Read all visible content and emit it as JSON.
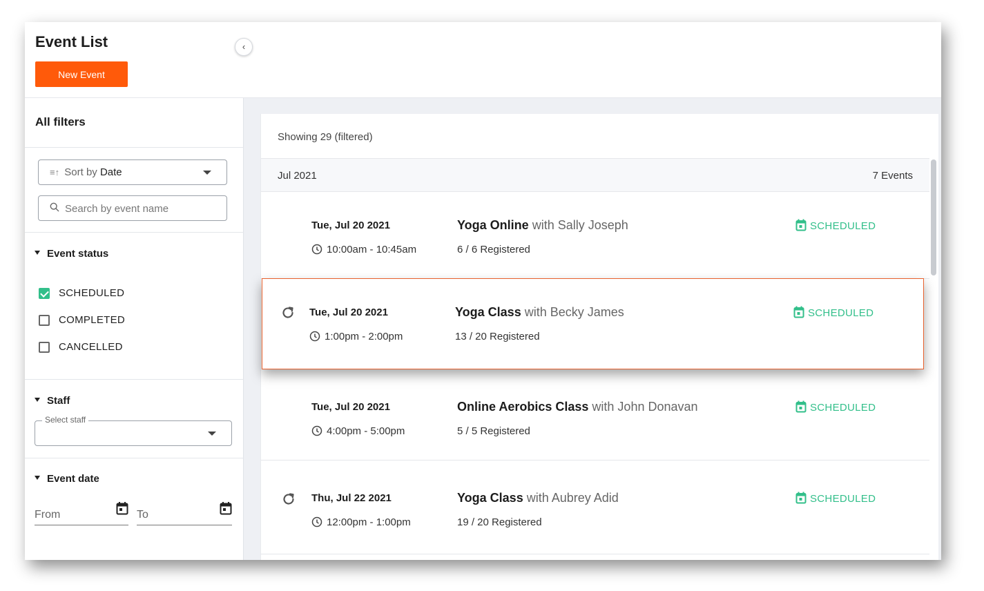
{
  "header": {
    "title": "Event List",
    "new_event_label": "New Event"
  },
  "sidebar": {
    "title": "All filters",
    "sort": {
      "prefix": "Sort by",
      "value": "Date"
    },
    "search": {
      "placeholder": "Search by event name"
    },
    "event_status": {
      "label": "Event status",
      "options": [
        {
          "label": "SCHEDULED",
          "checked": true
        },
        {
          "label": "COMPLETED",
          "checked": false
        },
        {
          "label": "CANCELLED",
          "checked": false
        }
      ]
    },
    "staff": {
      "label": "Staff",
      "legend": "Select staff"
    },
    "event_date": {
      "label": "Event date",
      "from_placeholder": "From",
      "to_placeholder": "To"
    }
  },
  "main": {
    "showing": "Showing 29 (filtered)",
    "month": {
      "label": "Jul 2021",
      "count": "7 Events"
    },
    "events": [
      {
        "date": "Tue, Jul 20 2021",
        "time": "10:00am - 10:45am",
        "title": "Yoga Online",
        "with": "with Sally Joseph",
        "registered": "6 / 6 Registered",
        "status": "SCHEDULED",
        "recurring": false
      },
      {
        "date": "Tue, Jul 20 2021",
        "time": "1:00pm - 2:00pm",
        "title": "Yoga Class",
        "with": "with Becky James",
        "registered": "13 / 20 Registered",
        "status": "SCHEDULED",
        "recurring": true
      },
      {
        "date": "Tue, Jul 20 2021",
        "time": "4:00pm - 5:00pm",
        "title": "Online Aerobics Class",
        "with": "with John Donavan",
        "registered": "5 / 5 Registered",
        "status": "SCHEDULED",
        "recurring": false
      },
      {
        "date": "Thu, Jul 22 2021",
        "time": "12:00pm - 1:00pm",
        "title": "Yoga Class",
        "with": "with Aubrey Adid",
        "registered": "19 / 20 Registered",
        "status": "SCHEDULED",
        "recurring": true
      }
    ]
  },
  "colors": {
    "accent": "#ff5a0a",
    "status_green": "#32bf8a",
    "highlight_border": "#e8602c"
  },
  "icons": [
    "chevron-left-icon",
    "sort-icon",
    "search-icon",
    "chevron-down-icon",
    "checkbox-icon",
    "calendar-icon",
    "clock-icon",
    "repeat-icon"
  ]
}
